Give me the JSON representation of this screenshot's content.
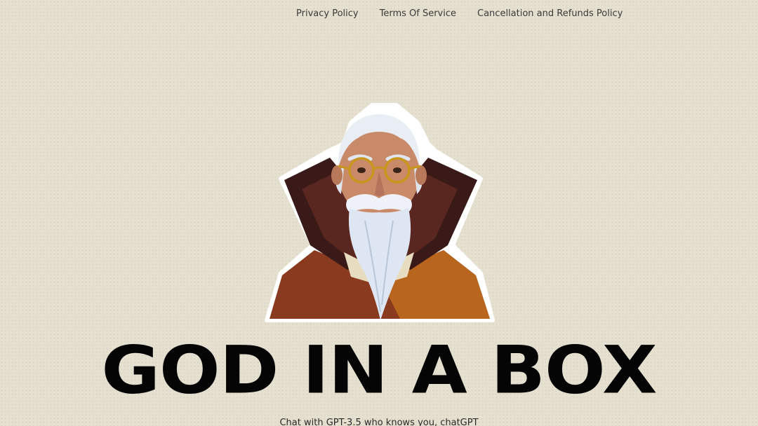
{
  "nav": {
    "links": [
      {
        "label": "Privacy Policy"
      },
      {
        "label": "Terms Of Service"
      },
      {
        "label": "Cancellation and Refunds Policy"
      }
    ]
  },
  "hero": {
    "title": "GOD IN A BOX",
    "subtitle": "Chat with GPT-3.5 who knows you, chatGPT"
  },
  "colors": {
    "background": "#e6e0d0",
    "title": "#050505",
    "nav_text": "#3a3a3a"
  }
}
